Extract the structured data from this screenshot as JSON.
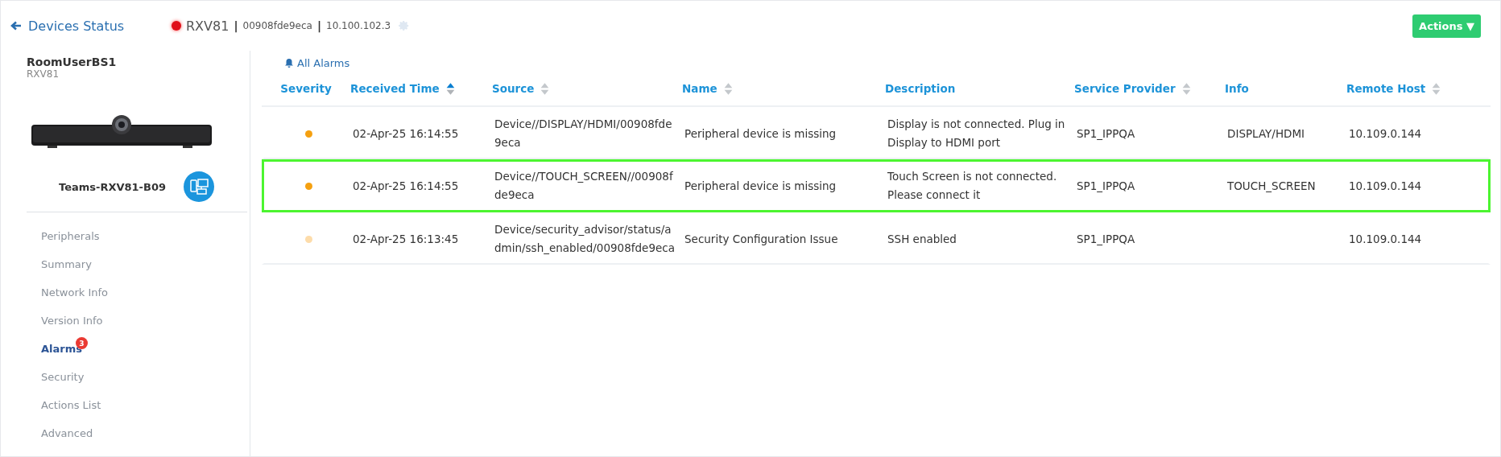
{
  "header": {
    "back_link": "Devices Status",
    "status": {
      "color": "#e0101a"
    },
    "device_name": "RXV81",
    "separator_1": "|",
    "mac": "00908fde9eca",
    "separator_2": "|",
    "ip": "10.100.102.3",
    "actions_button": "Actions ▼"
  },
  "sidebar": {
    "user": "RoomUserBS1",
    "model": "RXV81",
    "device_label": "Teams-RXV81-B09",
    "items": [
      {
        "label": "Peripherals",
        "selected": false
      },
      {
        "label": "Summary",
        "selected": false
      },
      {
        "label": "Network Info",
        "selected": false
      },
      {
        "label": "Version Info",
        "selected": false
      },
      {
        "label": "Alarms",
        "selected": true,
        "badge": "3"
      },
      {
        "label": "Security",
        "selected": false
      },
      {
        "label": "Actions List",
        "selected": false
      },
      {
        "label": "Advanced",
        "selected": false
      }
    ]
  },
  "alarms": {
    "title": "All Alarms",
    "columns": [
      {
        "label": "Severity",
        "sortable": false
      },
      {
        "label": "Received Time",
        "sortable": true,
        "sorted": true
      },
      {
        "label": "Source",
        "sortable": true,
        "sorted": false
      },
      {
        "label": "Name",
        "sortable": true,
        "sorted": false
      },
      {
        "label": "Description",
        "sortable": false
      },
      {
        "label": "Service Provider",
        "sortable": true,
        "sorted": false
      },
      {
        "label": "Info",
        "sortable": false
      },
      {
        "label": "Remote Host",
        "sortable": true,
        "sorted": false
      }
    ],
    "rows": [
      {
        "color": "#f5a010",
        "highlighted": false,
        "cells": [
          "",
          "02-Apr-25 16:14:55",
          "Device//DISPLAY/HDMI/00908fde9eca",
          "Peripheral device is missing",
          "Display is not connected. Plug in Display to HDMI port",
          "SP1_IPPQA",
          "DISPLAY/HDMI",
          "10.109.0.144"
        ]
      },
      {
        "color": "#f5a010",
        "highlighted": true,
        "cells": [
          "",
          "02-Apr-25 16:14:55",
          "Device//TOUCH_SCREEN//00908fde9eca",
          "Peripheral device is missing",
          "Touch Screen is not connected. Please connect it",
          "SP1_IPPQA",
          "TOUCH_SCREEN",
          "10.109.0.144"
        ]
      },
      {
        "color": "#fddcaa",
        "highlighted": false,
        "cells": [
          "",
          "02-Apr-25 16:13:45",
          "Device/security_advisor/status/admin/ssh_enabled/00908fde9eca",
          "Security Configuration Issue",
          "SSH enabled",
          "SP1_IPPQA",
          "",
          "10.109.0.144"
        ]
      }
    ]
  }
}
